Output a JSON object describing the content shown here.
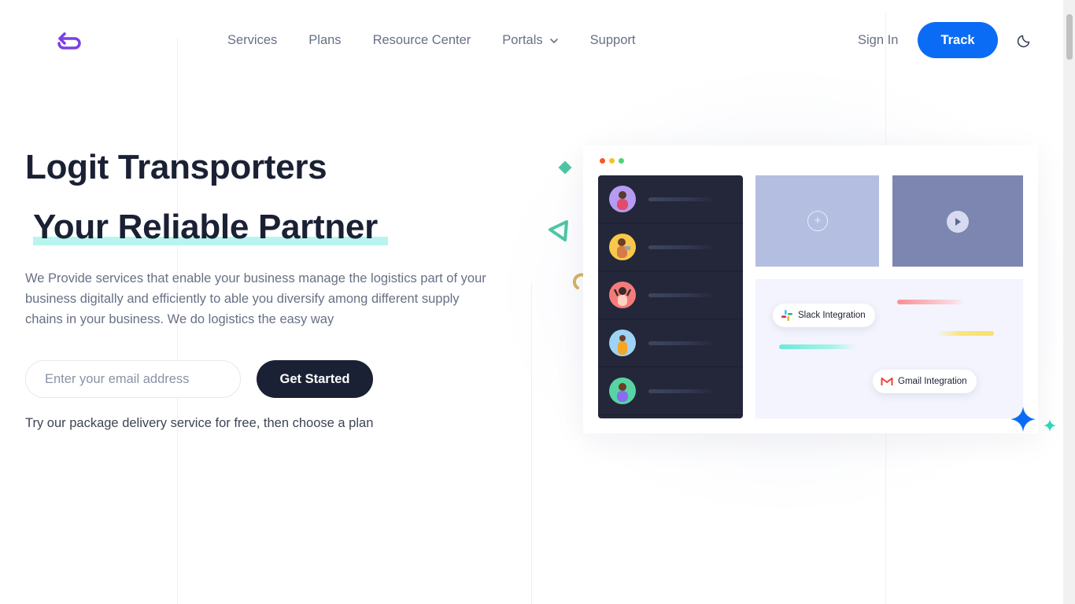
{
  "header": {
    "nav": [
      {
        "label": "Services"
      },
      {
        "label": "Plans"
      },
      {
        "label": "Resource Center"
      },
      {
        "label": "Portals",
        "has_dropdown": true
      },
      {
        "label": "Support"
      }
    ],
    "signin_label": "Sign In",
    "track_label": "Track",
    "logo_icon": "loop-arrow-logo-icon",
    "theme_icon": "moon-icon"
  },
  "hero": {
    "title": "Logit Transporters",
    "subtitle": "Your Reliable Partner",
    "description": "We Provide services that enable your business manage the logistics part of your business digitally and efficiently to able you diversify among different supply chains in your business. We do logistics the easy way",
    "email_placeholder": "Enter your email address",
    "email_value": "",
    "cta_label": "Get Started",
    "note": "Try our package delivery service for free, then choose a plan"
  },
  "illustration": {
    "integrations": [
      {
        "label": "Slack Integration",
        "icon": "slack-icon"
      },
      {
        "label": "Gmail Integration",
        "icon": "gmail-icon"
      }
    ],
    "avatars": 5
  },
  "colors": {
    "accent": "#0a6cf5",
    "dark": "#1b2134",
    "highlight": "#b7f5ee",
    "logo": "#7b3fe4",
    "muted_text": "#677084"
  }
}
